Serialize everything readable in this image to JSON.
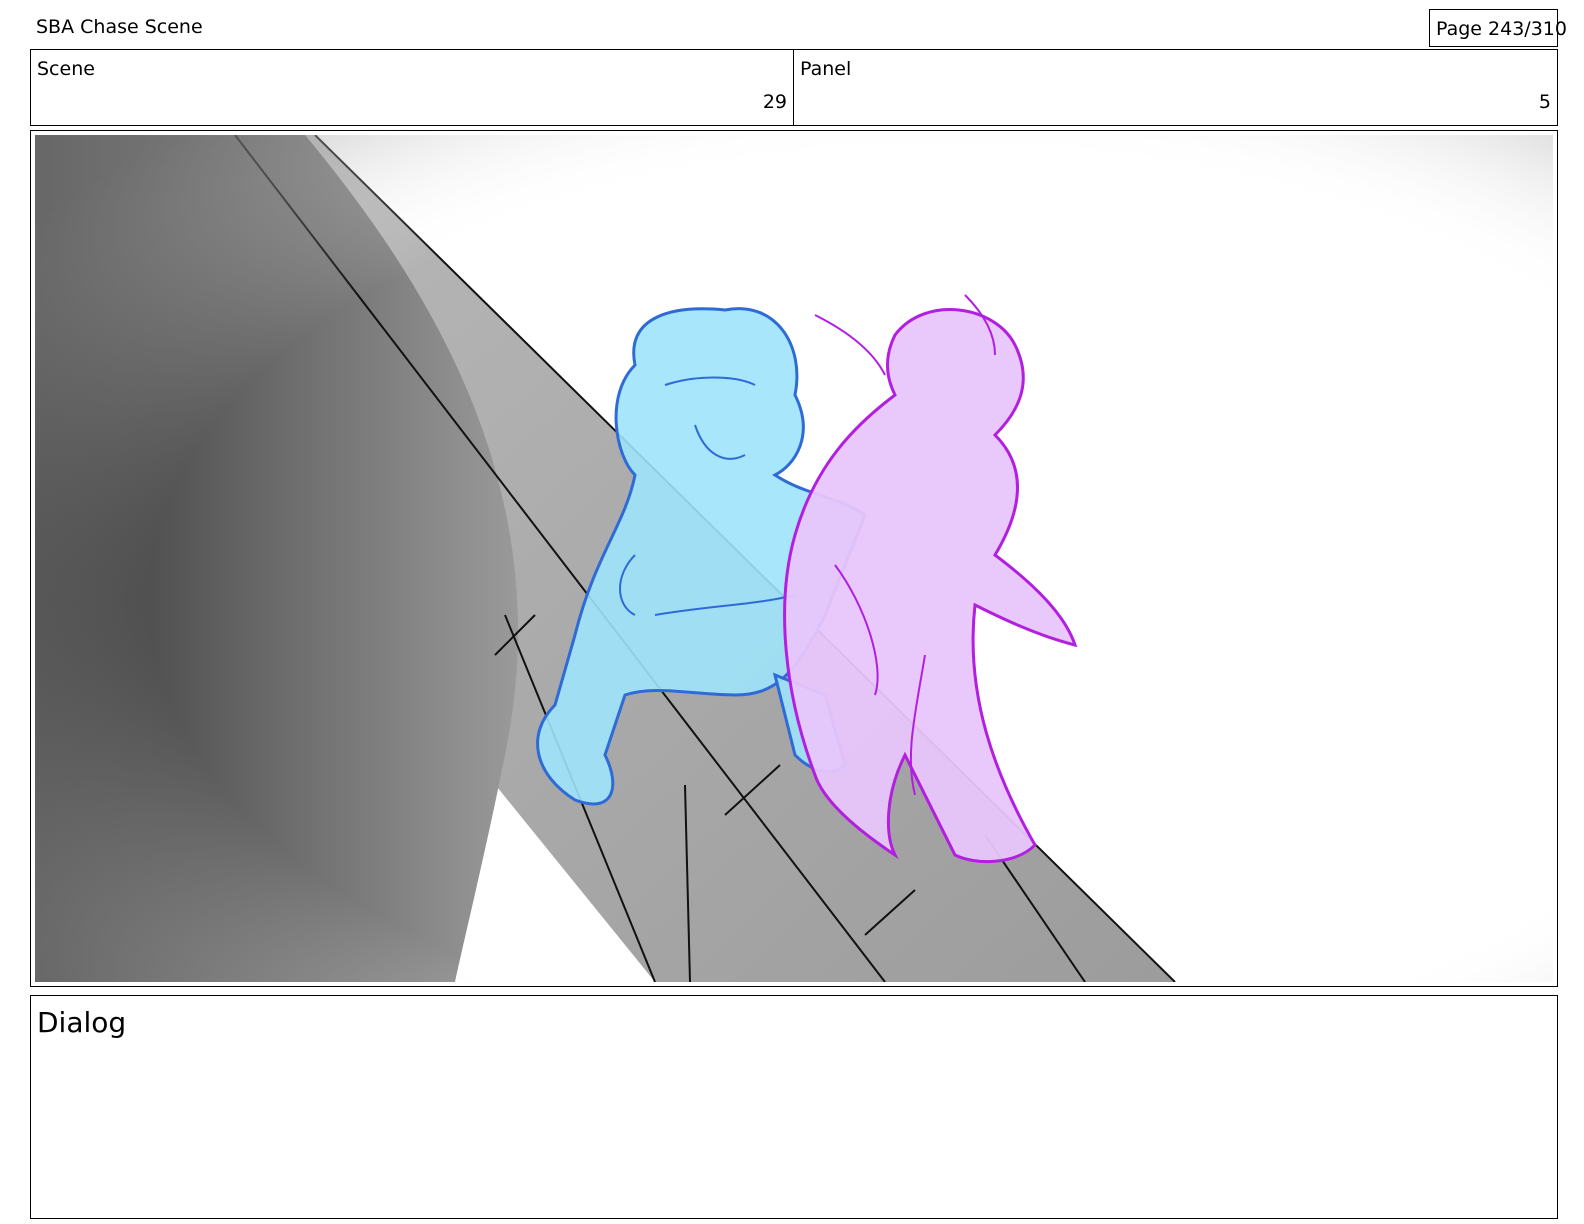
{
  "header": {
    "project_title": "SBA Chase Scene",
    "page_indicator": "Page 243/310"
  },
  "scene": {
    "label": "Scene",
    "value": "29"
  },
  "panel": {
    "label": "Panel",
    "value": "5"
  },
  "dialog": {
    "label": "Dialog",
    "text": ""
  },
  "colors": {
    "blue_character_fill": "#9fe3fb",
    "blue_character_line": "#2f6bd6",
    "pink_character_fill": "#e8c6fb",
    "pink_character_line": "#b21fe0",
    "wall_dark": "#3c3c3c",
    "walkway_gray": "#a3a3a3"
  }
}
